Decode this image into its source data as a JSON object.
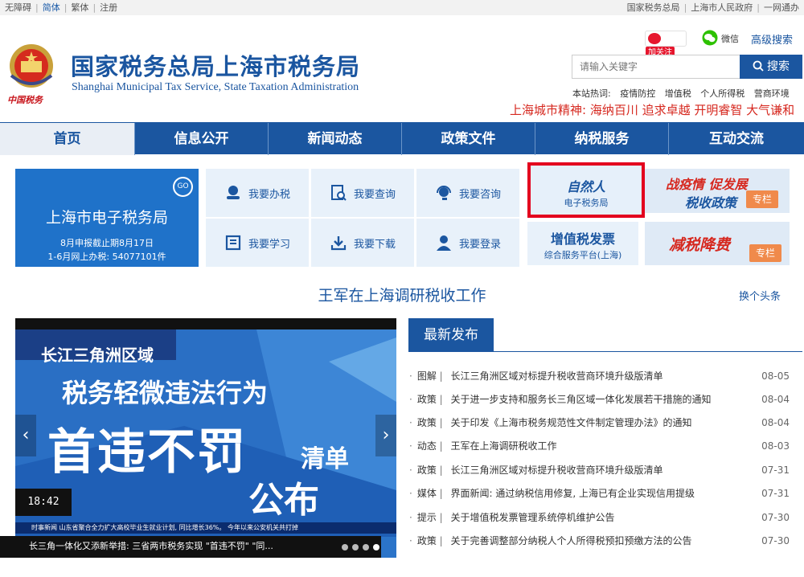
{
  "topbar": {
    "left": [
      "无障碍",
      "简体",
      "繁体",
      "注册"
    ],
    "right": [
      "国家税务总局",
      "上海市人民政府",
      "一网通办"
    ]
  },
  "header": {
    "title_cn": "国家税务总局上海市税务局",
    "title_en": "Shanghai Municipal Tax Service, State Taxation Administration",
    "emblem_text": "中国税务",
    "weibo_label": "加关注",
    "wechat_label": "微信",
    "advanced_search": "高级搜索",
    "search_placeholder": "请输入关键字",
    "search_button": "搜索",
    "hot_label": "本站热词:",
    "hot_words": [
      "疫情防控",
      "增值税",
      "个人所得税",
      "营商环境"
    ],
    "city_spirit": "上海城市精神:  海纳百川 追求卓越 开明睿智 大气谦和"
  },
  "nav": [
    "首页",
    "信息公开",
    "新闻动态",
    "政策文件",
    "纳税服务",
    "互动交流"
  ],
  "etax": {
    "title": "上海市电子税务局",
    "line1": "8月申报截止期8月17日",
    "line2": "1-6月网上办税: 54077101件",
    "go": "GO"
  },
  "services": [
    "我要办税",
    "我要查询",
    "我要咨询",
    "我要学习",
    "我要下载",
    "我要登录"
  ],
  "banners": {
    "natural_title": "自然人",
    "natural_sub": "电子税务局",
    "vat_title": "增值税发票",
    "vat_sub": "综合服务平台(上海)",
    "promo1_line1": "战疫情 促发展",
    "promo1_line2": "税收政策",
    "promo2_line1": "减税降费",
    "special": "专栏"
  },
  "headline": {
    "title": "王军在上海调研税收工作",
    "swap": "换个头条"
  },
  "slider": {
    "channel": "长江三角洲区域",
    "line1": "税务轻微违法行为",
    "line2": "首违不罚",
    "line2b": "清单",
    "line3": "公布",
    "ticker_time": "18:42",
    "ticker_text": "时事新闻  山东省聚合全力扩大高校毕业生就业计划, 同比增长36%。  今年以来公安机关共打掉",
    "caption": "长三角一体化又添新举措: 三省两市税务实现 \"首违不罚\" \"同..."
  },
  "latest": {
    "tab": "最新发布",
    "items": [
      {
        "type": "图解",
        "title": "长江三角洲区域对标提升税收营商环境升级版清单",
        "date": "08-05"
      },
      {
        "type": "政策",
        "title": "关于进一步支持和服务长三角区域一体化发展若干措施的通知",
        "date": "08-04"
      },
      {
        "type": "政策",
        "title": "关于印发《上海市税务规范性文件制定管理办法》的通知",
        "date": "08-04"
      },
      {
        "type": "动态",
        "title": "王军在上海调研税收工作",
        "date": "08-03"
      },
      {
        "type": "政策",
        "title": "长江三角洲区域对标提升税收营商环境升级版清单",
        "date": "07-31"
      },
      {
        "type": "媒体",
        "title": "界面新闻: 通过纳税信用修复, 上海已有企业实现信用提级",
        "date": "07-31"
      },
      {
        "type": "提示",
        "title": "关于增值税发票管理系统停机维护公告",
        "date": "07-30"
      },
      {
        "type": "政策",
        "title": "关于完善调整部分纳税人个人所得税预扣预缴方法的公告",
        "date": "07-30"
      }
    ]
  },
  "colors": {
    "brand": "#1b56a0",
    "red": "#d6281f",
    "light": "#e8f1fa"
  }
}
